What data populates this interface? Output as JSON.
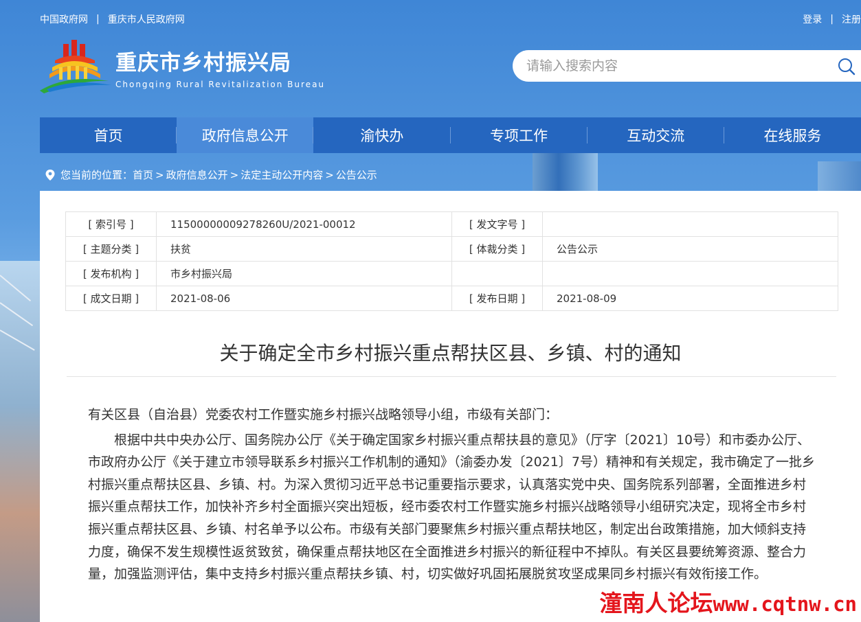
{
  "topbar": {
    "links": [
      "中国政府网",
      "重庆市人民政府网"
    ],
    "separator": "|",
    "login": "登录",
    "register": "注册"
  },
  "logo": {
    "title": "重庆市乡村振兴局",
    "subtitle": "Chongqing Rural Revitalization Bureau"
  },
  "search": {
    "placeholder": "请输入搜索内容",
    "icon": "search-icon"
  },
  "nav": {
    "items": [
      "首页",
      "政府信息公开",
      "渝快办",
      "专项工作",
      "互动交流",
      "在线服务"
    ],
    "active_index": 1
  },
  "breadcrumb": {
    "prefix": "您当前的位置：",
    "items": [
      "首页",
      "政府信息公开",
      "法定主动公开内容",
      "公告公示"
    ],
    "separator": ">"
  },
  "meta": {
    "index_label": "[ 索引号 ]",
    "index_value": "11500000009278260U/2021-00012",
    "docno_label": "[ 发文字号 ]",
    "docno_value": "",
    "topic_label": "[ 主题分类 ]",
    "topic_value": "扶贫",
    "genre_label": "[ 体裁分类 ]",
    "genre_value": "公告公示",
    "org_label": "[ 发布机构 ]",
    "org_value": "市乡村振兴局",
    "created_label": "[ 成文日期 ]",
    "created_value": "2021-08-06",
    "published_label": "[ 发布日期 ]",
    "published_value": "2021-08-09"
  },
  "article": {
    "title": "关于确定全市乡村振兴重点帮扶区县、乡镇、村的通知",
    "salutation": "有关区县（自治县）党委农村工作暨实施乡村振兴战略领导小组，市级有关部门：",
    "body": "根据中共中央办公厅、国务院办公厅《关于确定国家乡村振兴重点帮扶县的意见》（厅字〔2021〕10号）和市委办公厅、市政府办公厅《关于建立市领导联系乡村振兴工作机制的通知》（渝委办发〔2021〕7号）精神和有关规定，我市确定了一批乡村振兴重点帮扶区县、乡镇、村。为深入贯彻习近平总书记重要指示要求，认真落实党中央、国务院系列部署，全面推进乡村振兴重点帮扶工作，加快补齐乡村全面振兴突出短板，经市委农村工作暨实施乡村振兴战略领导小组研究决定，现将全市乡村振兴重点帮扶区县、乡镇、村名单予以公布。市级有关部门要聚焦乡村振兴重点帮扶地区，制定出台政策措施，加大倾斜支持力度，确保不发生规模性返贫致贫，确保重点帮扶地区在全面推进乡村振兴的新征程中不掉队。有关区县要统筹资源、整合力量，加强监测评估，集中支持乡村振兴重点帮扶乡镇、村，切实做好巩固拓展脱贫攻坚成果同乡村振兴有效衔接工作。"
  },
  "watermark": {
    "cn": "潼南人论坛",
    "url": "www.cqtnw.cn"
  },
  "colors": {
    "nav_bg": "#2566bf",
    "nav_active": "#4a8ad9",
    "watermark": "#e4151c"
  }
}
